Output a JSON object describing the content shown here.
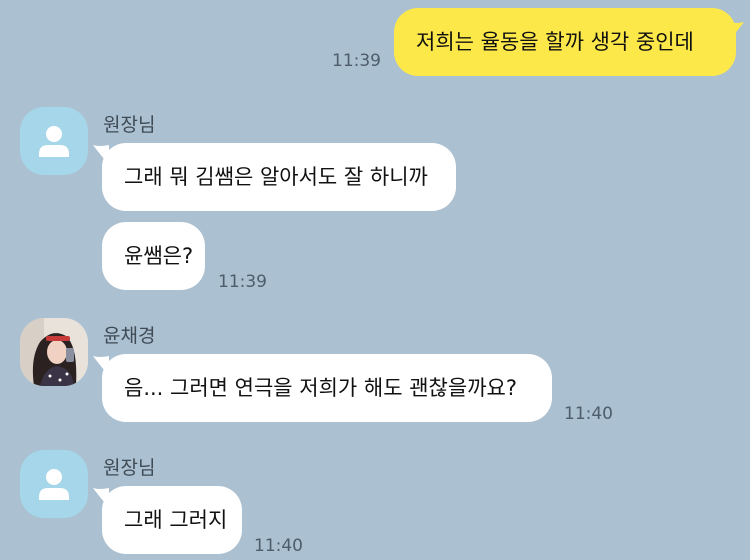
{
  "chat": {
    "messages": [
      {
        "text": "저희는 율동을 할까 생각 중인데",
        "time": "11:39"
      },
      {
        "sender": "원장님",
        "text": "그래 뭐 김쌤은 알아서도 잘 하니까"
      },
      {
        "text": "윤쌤은?",
        "time": "11:39"
      },
      {
        "sender": "윤채경",
        "text": "음... 그러면 연극을 저희가 해도 괜찮을까요?",
        "time": "11:40"
      },
      {
        "sender": "원장님",
        "text": "그래 그러지",
        "time": "11:40"
      }
    ]
  },
  "colors": {
    "background": "#abc0d1",
    "outgoing_bubble": "#fde84a",
    "incoming_bubble": "#ffffff",
    "default_avatar": "#a6d6e9"
  },
  "icons": {
    "default_avatar": "person-silhouette-icon",
    "user_avatar": "profile-photo"
  }
}
